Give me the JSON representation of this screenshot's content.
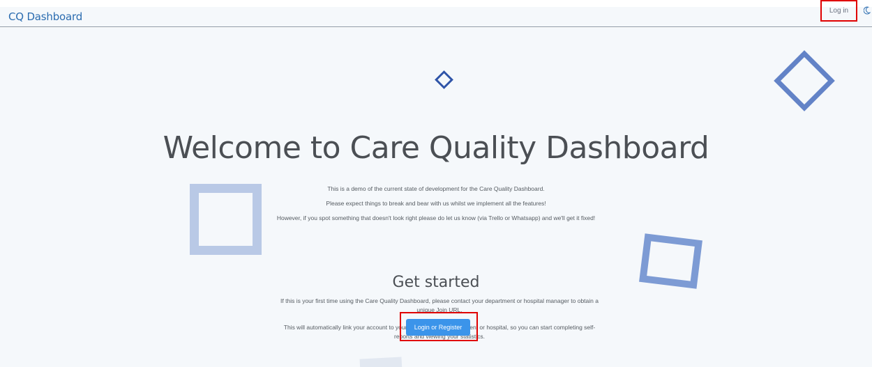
{
  "navbar": {
    "brand": "CQ Dashboard",
    "login_label": "Log in",
    "theme_icon": "moon-icon"
  },
  "hero": {
    "title": "Welcome to Care Quality Dashboard",
    "demo_lines": [
      "This is a demo of the current state of development for the Care Quality Dashboard.",
      "Please expect things to break and bear with us whilst we implement all the features!",
      "However, if you spot something that doesn't look right please do let us know (via Trello or Whatsapp) and we'll get it fixed!"
    ]
  },
  "get_started": {
    "heading": "Get started",
    "paragraphs": [
      "If this is your first time using the Care Quality Dashboard, please contact your department or hospital manager to obtain a unique Join URL.",
      "This will automatically link your account to your corresponding department or hospital, so you can start completing self-reports and viewing your statistics."
    ],
    "button_label": "Login or Register"
  },
  "colors": {
    "brand": "#2b6cb0",
    "button": "#3b94ea",
    "highlight": "#e00000",
    "background": "#f5f8fb"
  }
}
